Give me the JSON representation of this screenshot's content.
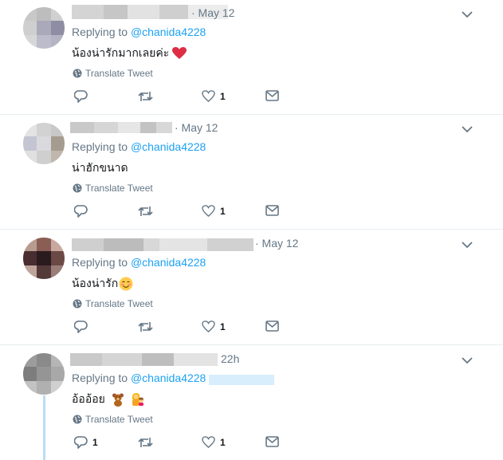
{
  "tweets": [
    {
      "date": "· May 12",
      "replying_prefix": "Replying to",
      "handle": "@chanida4228",
      "text": "น้องน่ารักมากเลยค่ะ",
      "text_emoji": "red-heart",
      "translate": "Translate Tweet",
      "reply_count": "",
      "like_count": "1"
    },
    {
      "date": "· May 12",
      "replying_prefix": "Replying to",
      "handle": "@chanida4228",
      "text": "น่าฮักขนาด",
      "text_emoji": "",
      "translate": "Translate Tweet",
      "reply_count": "",
      "like_count": "1"
    },
    {
      "date": "· May 12",
      "replying_prefix": "Replying to",
      "handle": "@chanida4228",
      "text": "น้องน่ารัก",
      "text_emoji": "smiling-face",
      "translate": "Translate Tweet",
      "reply_count": "",
      "like_count": "1"
    },
    {
      "date": "22h",
      "replying_prefix": "Replying to",
      "handle": "@chanida4228",
      "text": "อ้ออ้อย",
      "text_emoji": "teddy-bear-and-family",
      "translate": "Translate Tweet",
      "reply_count": "1",
      "like_count": "1"
    }
  ],
  "colors": {
    "link": "#1da1f2",
    "muted": "#657786",
    "heart": "#e0245e",
    "thread": "#b8ddf5"
  }
}
